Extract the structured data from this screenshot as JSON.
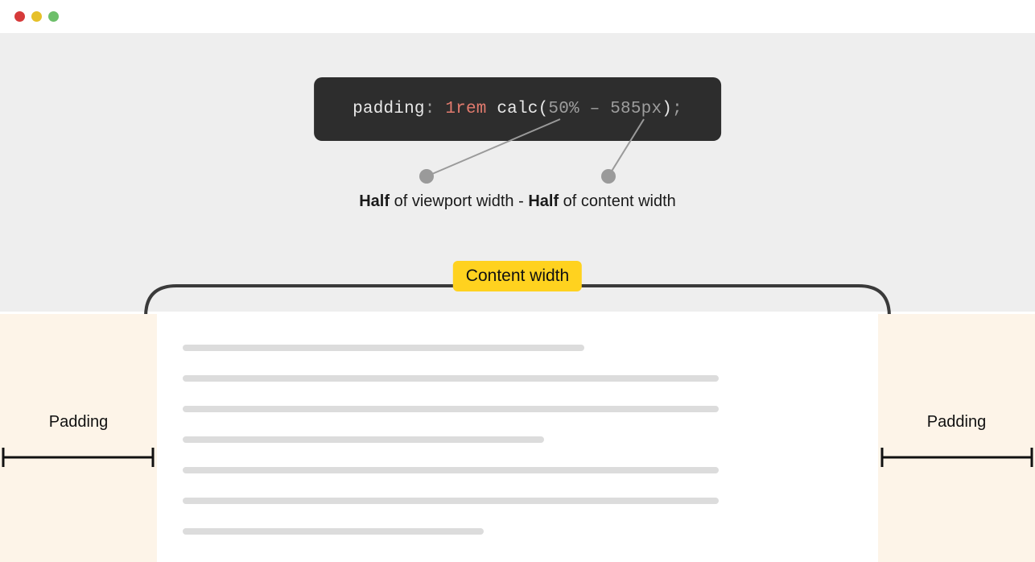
{
  "window": {
    "dots": [
      "close",
      "minimize",
      "zoom"
    ]
  },
  "code": {
    "prop": "padding",
    "value1": "1rem",
    "func": "calc",
    "pct": "50",
    "pct_unit": "%",
    "minus": "–",
    "px": "585px"
  },
  "explain": {
    "half1": "Half",
    "seg1": " of viewport width - ",
    "half2": "Half",
    "seg2": " of content width"
  },
  "badge": "Content width",
  "padding_label_left": "Padding",
  "padding_label_right": "Padding"
}
